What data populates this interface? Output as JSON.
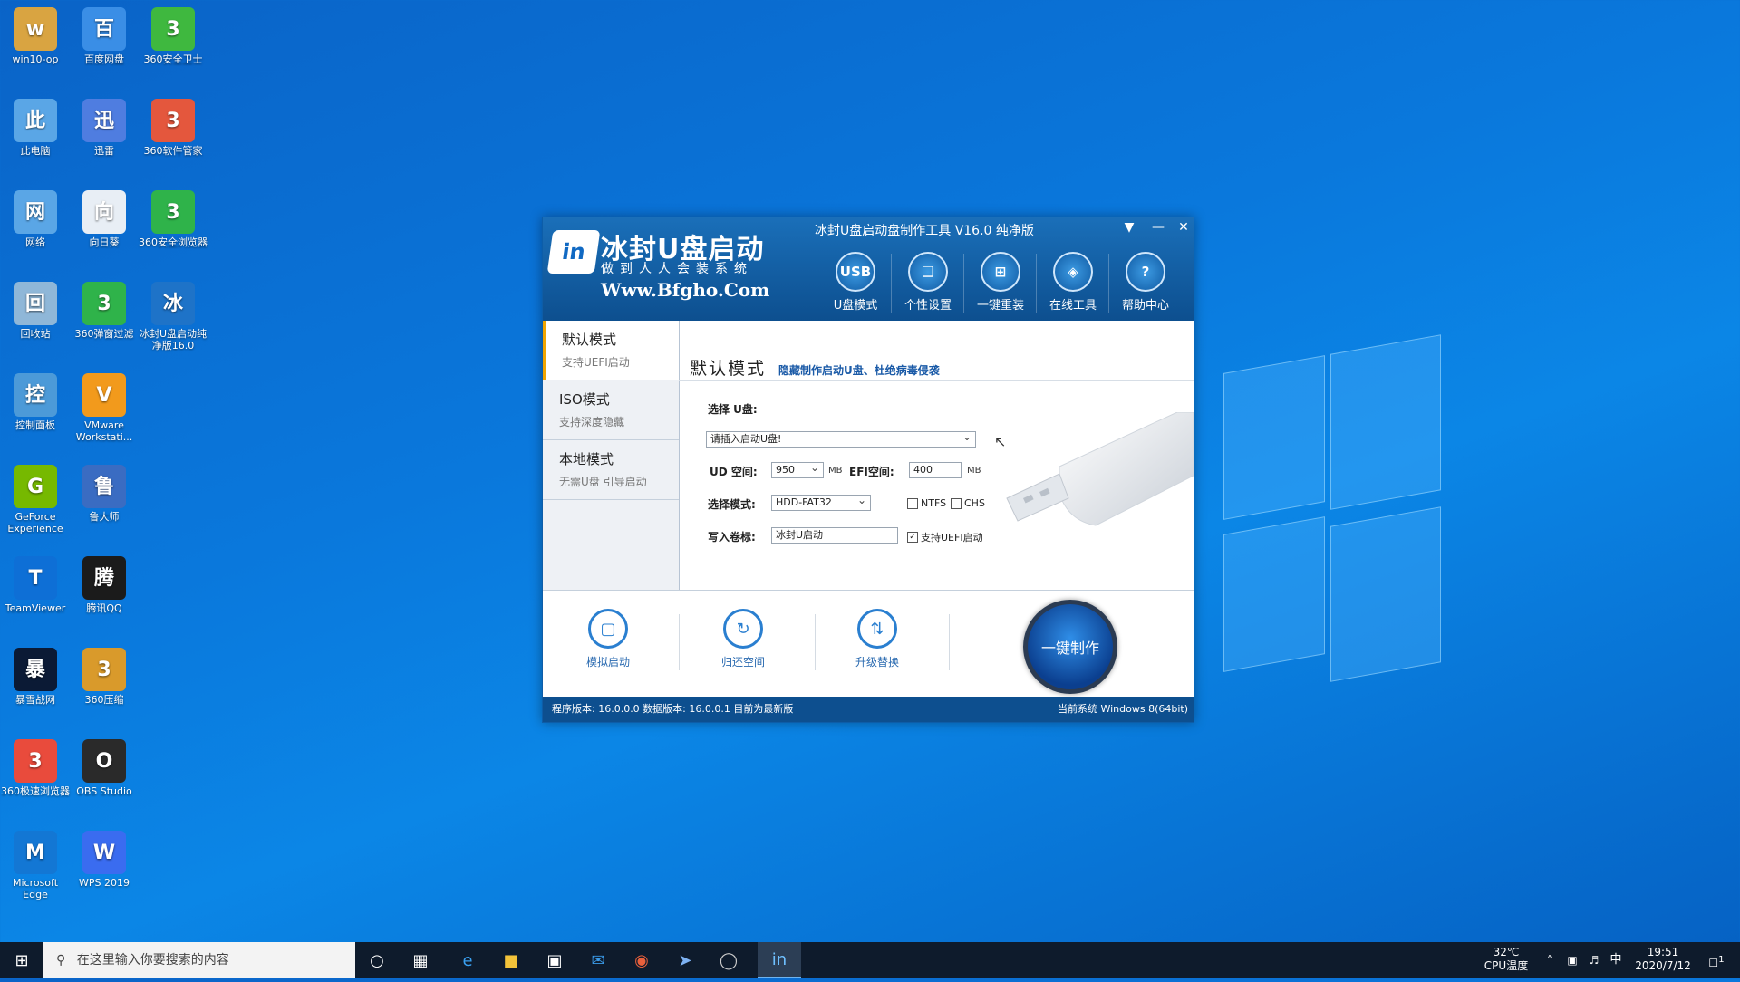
{
  "desktop_icons": [
    {
      "label": "win10-op",
      "icon": "user-folder-icon",
      "color": "#d9a441"
    },
    {
      "label": "百度网盘",
      "icon": "baidu-netdisk-icon",
      "color": "#3a8ee6"
    },
    {
      "label": "360安全卫士",
      "icon": "360-security-icon",
      "color": "#3fb83f"
    },
    {
      "label": "此电脑",
      "icon": "computer-icon",
      "color": "#5aa6e6"
    },
    {
      "label": "迅雷",
      "icon": "thunder-icon",
      "color": "#4f7de0"
    },
    {
      "label": "360软件管家",
      "icon": "360-software-icon",
      "color": "#e4573d"
    },
    {
      "label": "网络",
      "icon": "network-icon",
      "color": "#5aa6e6"
    },
    {
      "label": "向日葵",
      "icon": "sunflower-icon",
      "color": "#e8eef5"
    },
    {
      "label": "360安全浏览器",
      "icon": "360-browser-icon",
      "color": "#2fb34a"
    },
    {
      "label": "回收站",
      "icon": "recycle-bin-icon",
      "color": "#8fb7d8"
    },
    {
      "label": "360弹窗过滤",
      "icon": "360-popup-filter-icon",
      "color": "#2fb34a"
    },
    {
      "label": "冰封U盘启动纯净版16.0",
      "icon": "bingfeng-icon",
      "color": "#1e73c8"
    },
    {
      "label": "控制面板",
      "icon": "control-panel-icon",
      "color": "#4c9ad8"
    },
    {
      "label": "VMware Workstati...",
      "icon": "vmware-icon",
      "color": "#f29a1c"
    },
    {
      "label": "GeForce Experience",
      "icon": "geforce-icon",
      "color": "#76b900"
    },
    {
      "label": "鲁大师",
      "icon": "ludashi-icon",
      "color": "#3a6cc2"
    },
    {
      "label": "TeamViewer",
      "icon": "teamviewer-icon",
      "color": "#0e6fd6"
    },
    {
      "label": "腾讯QQ",
      "icon": "qq-icon",
      "color": "#1b1b1b"
    },
    {
      "label": "暴雪战网",
      "icon": "battlenet-icon",
      "color": "#0b1a35"
    },
    {
      "label": "360压缩",
      "icon": "360-zip-icon",
      "color": "#d99a2b"
    },
    {
      "label": "360极速浏览器",
      "icon": "360-speed-browser-icon",
      "color": "#e94b3c"
    },
    {
      "label": "OBS Studio",
      "icon": "obs-icon",
      "color": "#2a2a2a"
    },
    {
      "label": "Microsoft Edge",
      "icon": "edge-icon",
      "color": "#1377d4"
    },
    {
      "label": "WPS 2019",
      "icon": "wps-icon",
      "color": "#3a6cf0"
    }
  ],
  "app": {
    "title": "冰封U盘启动盘制作工具 V16.0 纯净版",
    "logo_title": "冰封U盘启动",
    "logo_sub": "做到人人会装系统",
    "logo_url": "Www.Bfgho.Com",
    "top_nav": [
      {
        "label": "U盘模式",
        "icon": "usb-icon"
      },
      {
        "label": "个性设置",
        "icon": "shirt-icon"
      },
      {
        "label": "一键重装",
        "icon": "windows-icon"
      },
      {
        "label": "在线工具",
        "icon": "globe-icon"
      },
      {
        "label": "帮助中心",
        "icon": "help-icon"
      }
    ],
    "left_nav": [
      {
        "title": "默认模式",
        "sub": "支持UEFI启动"
      },
      {
        "title": "ISO模式",
        "sub": "支持深度隐藏"
      },
      {
        "title": "本地模式",
        "sub": "无需U盘 引导启动"
      }
    ],
    "main": {
      "title": "默认模式",
      "subtitle": "隐藏制作启动U盘、杜绝病毒侵袭",
      "select_label": "选择 U盘:",
      "select_value": "请插入启动U盘!",
      "ud_label": "UD 空间:",
      "ud_value": "950",
      "mb1": "MB",
      "efi_label": "EFI空间:",
      "efi_value": "400",
      "mb2": "MB",
      "mode_label": "选择模式:",
      "mode_value": "HDD-FAT32",
      "ntfs": "NTFS",
      "chs": "CHS",
      "vol_label": "写入卷标:",
      "vol_value": "冰封U启动",
      "uefi": "支持UEFI启动"
    },
    "bottom": [
      {
        "label": "模拟启动",
        "icon": "monitor-icon"
      },
      {
        "label": "归还空间",
        "icon": "restore-icon"
      },
      {
        "label": "升级替换",
        "icon": "upgrade-icon"
      }
    ],
    "big_button": "一键制作",
    "status_left": "程序版本: 16.0.0.0 数据版本: 16.0.0.1 目前为最新版",
    "status_right": "当前系统 Windows 8(64bit)"
  },
  "taskbar": {
    "search_placeholder": "在这里输入你要搜索的内容",
    "temp": "32℃",
    "temp_label": "CPU温度",
    "ime": "中",
    "time": "19:51",
    "date": "2020/7/12",
    "notif": "1"
  }
}
